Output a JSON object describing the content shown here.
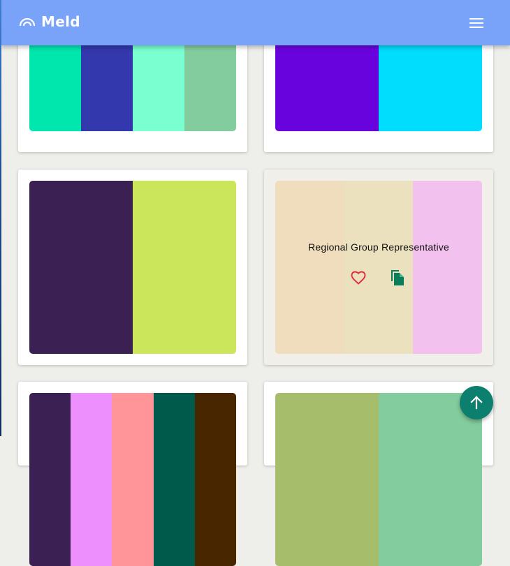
{
  "app": {
    "brand_name": "Meld",
    "logo_icon": "rainbow-arcs-icon",
    "menu_icon": "hamburger-menu-icon"
  },
  "colors": {
    "header": "#79a3f9",
    "fab": "#0d7f6f",
    "heart": "#e52b3b",
    "copy": "#0a7d5a"
  },
  "palettes": [
    {
      "colors": [
        "#00e7ad",
        "#3338ac",
        "#79ffd0",
        "#83cc9d"
      ]
    },
    {
      "colors": [
        "#6903de",
        "#00ddfd"
      ]
    },
    {
      "colors": [
        "#3a2053",
        "#cbe65b"
      ]
    },
    {
      "colors": [
        "#efddbd",
        "#ebe1be",
        "#f3c1ed"
      ],
      "hover": {
        "title": "Regional Group Representative",
        "favorite_icon": "heart-outline-icon",
        "copy_icon": "copy-icon"
      }
    },
    {
      "colors": [
        "#3a2053",
        "#ee8ffe",
        "#ff9598",
        "#005a4b",
        "#472600"
      ]
    },
    {
      "colors": [
        "#a6bd6b",
        "#83cc9d"
      ]
    }
  ],
  "scroll_top_icon": "arrow-up-icon"
}
